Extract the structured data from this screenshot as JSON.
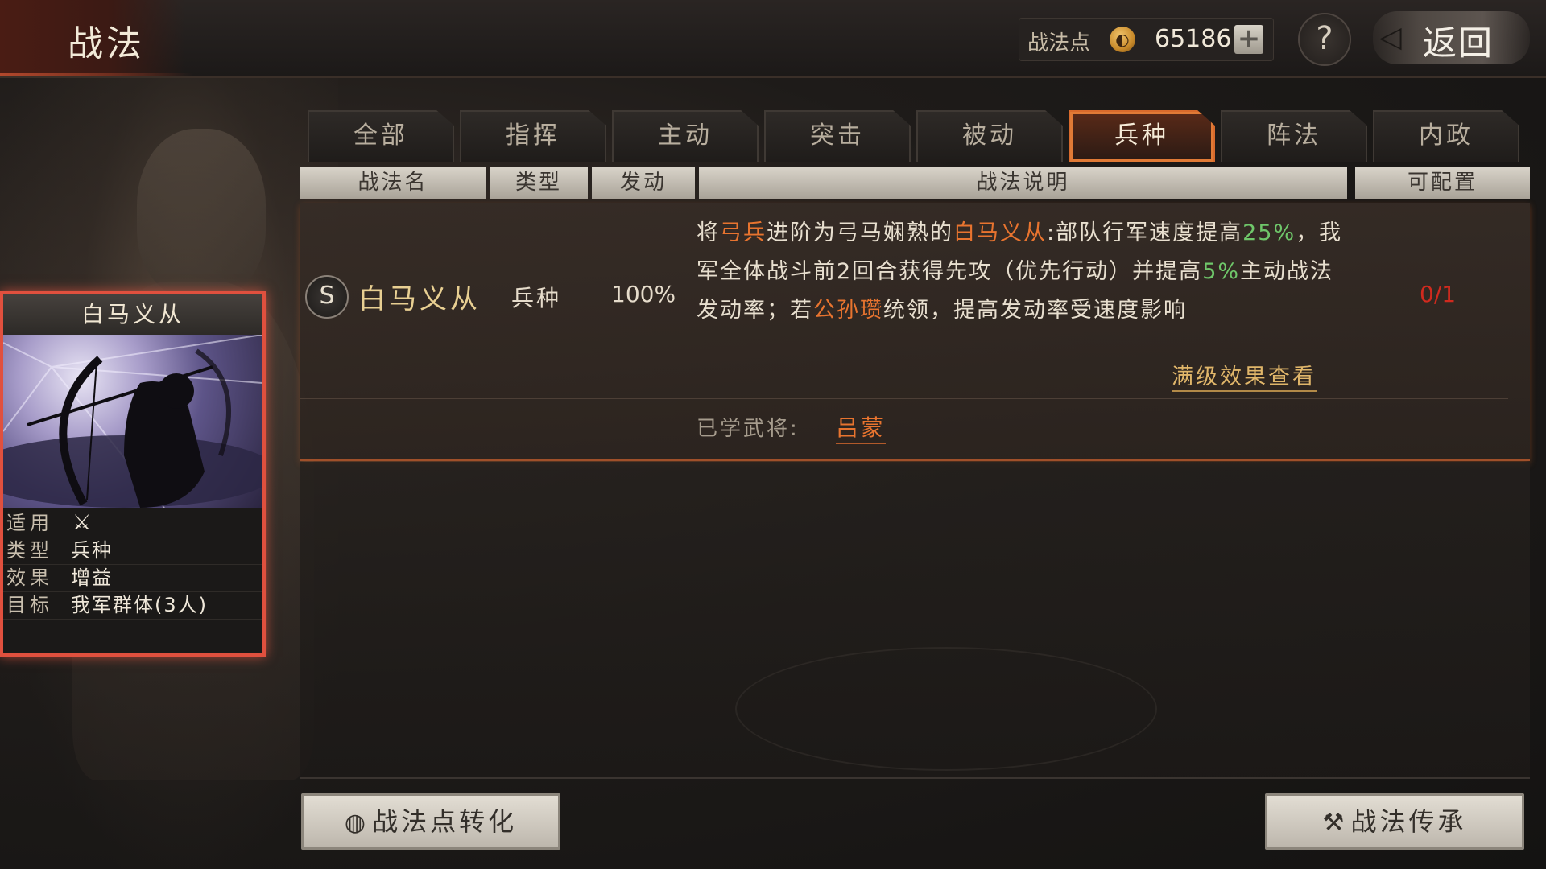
{
  "header": {
    "title": "战法",
    "points_label": "战法点",
    "points_value": "65186",
    "plus": "+",
    "help": "?",
    "back_label": "返回"
  },
  "tabs": [
    {
      "label": "全部",
      "active": false
    },
    {
      "label": "指挥",
      "active": false
    },
    {
      "label": "主动",
      "active": false
    },
    {
      "label": "突击",
      "active": false
    },
    {
      "label": "被动",
      "active": false
    },
    {
      "label": "兵种",
      "active": true
    },
    {
      "label": "阵法",
      "active": false
    },
    {
      "label": "内政",
      "active": false
    }
  ],
  "columns": {
    "name": "战法名",
    "type": "类型",
    "rate": "发动",
    "desc": "战法说明",
    "config": "可配置"
  },
  "skill": {
    "grade": "S",
    "name": "白马义从",
    "type": "兵种",
    "rate": "100%",
    "desc": {
      "p1": "将",
      "h1": "弓兵",
      "p2": "进阶为弓马娴熟的",
      "h2": "白马义从",
      "p3": ":部队行军速度提高",
      "g1": "25%",
      "p4": "，我军全体战斗前2回合获得先攻（优先行动）并提高",
      "g2": "5%",
      "p5": "主动战法发动率；若",
      "h3": "公孙瓒",
      "p6": "统领，提高发动率受速度影响"
    },
    "config": "0/1",
    "full_level_link": "满级效果查看",
    "learned_label": "已学武将:",
    "learned_general": "吕蒙"
  },
  "card": {
    "title": "白马义从",
    "attrs": [
      {
        "label": "适用",
        "value": "",
        "icon": "crossed-bow-icon"
      },
      {
        "label": "类型",
        "value": "兵种"
      },
      {
        "label": "效果",
        "value": "增益"
      },
      {
        "label": "目标",
        "value": "我军群体(3人)"
      }
    ]
  },
  "buttons": {
    "convert": "战法点转化",
    "inherit": "战法传承"
  },
  "colors": {
    "highlight_orange": "#e8742f",
    "highlight_green": "#6fc76a",
    "config_red": "#d02a1e",
    "tab_active_border": "#e07a36"
  }
}
